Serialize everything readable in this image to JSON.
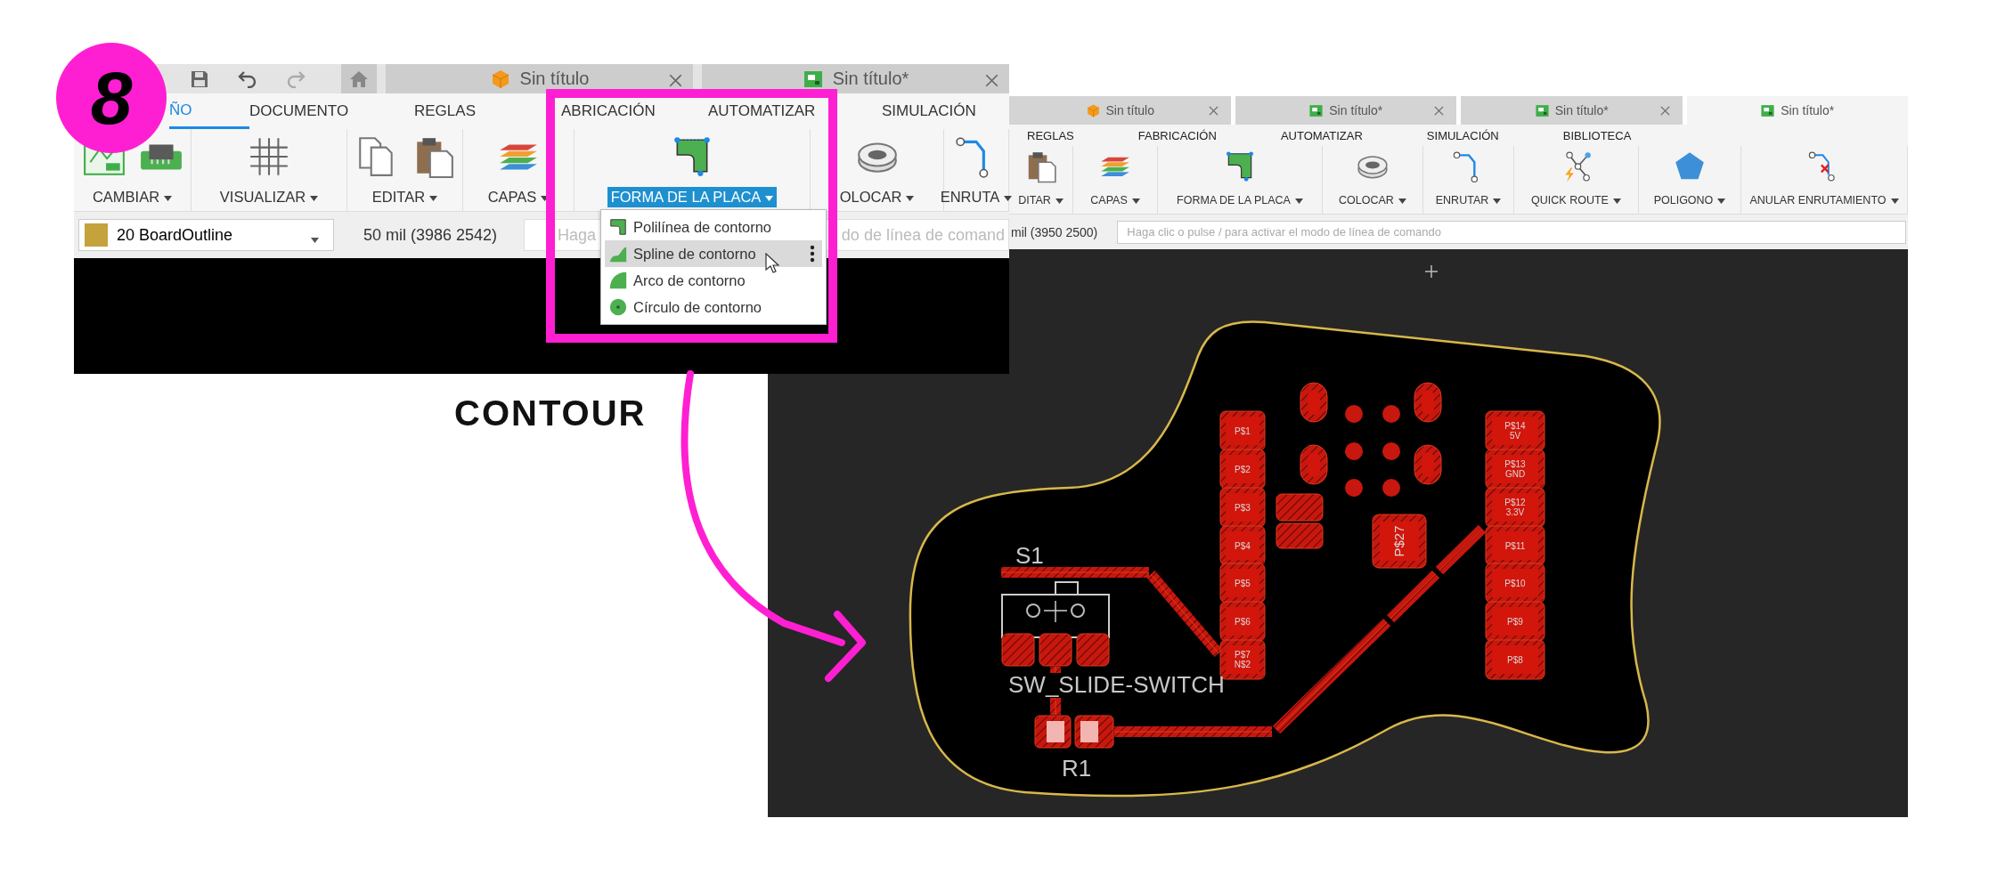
{
  "step_badge": "8",
  "caption": "CONTOUR",
  "left_window": {
    "doc_tabs": [
      {
        "label": "Sin título",
        "selected": false
      },
      {
        "label": "Sin título*",
        "selected": false
      }
    ],
    "ribbon_tabs": [
      {
        "label": "ÑO",
        "selected": true
      },
      {
        "label": "DOCUMENTO",
        "selected": false
      },
      {
        "label": "REGLAS",
        "selected": false
      },
      {
        "label": "ABRICACIÓN",
        "selected": false
      },
      {
        "label": "AUTOMATIZAR",
        "selected": false
      },
      {
        "label": "SIMULACIÓN",
        "selected": false
      }
    ],
    "tool_groups": [
      {
        "label": "CAMBIAR",
        "selected": false
      },
      {
        "label": "VISUALIZAR",
        "selected": false
      },
      {
        "label": "EDITAR",
        "selected": false
      },
      {
        "label": "CAPAS",
        "selected": false
      },
      {
        "label": "FORMA DE LA PLACA",
        "selected": true
      },
      {
        "label": "OLOCAR",
        "selected": false
      },
      {
        "label": "ENRUTA",
        "selected": false
      }
    ],
    "layer": "20 BoardOutline",
    "coordinates": "50 mil (3986 2542)",
    "command_placeholder_parts": [
      "Haga",
      "do de línea de comand"
    ],
    "menu": [
      {
        "label": "Polilínea de contorno",
        "selected": false
      },
      {
        "label": "Spline de contorno",
        "selected": true
      },
      {
        "label": "Arco de contorno",
        "selected": false
      },
      {
        "label": "Círculo de contorno",
        "selected": false
      }
    ]
  },
  "right_window": {
    "doc_tabs": [
      {
        "label": "Sin título",
        "selected": false
      },
      {
        "label": "Sin título*",
        "selected": false
      },
      {
        "label": "Sin título*",
        "selected": false
      },
      {
        "label": "Sin título*",
        "selected": true
      }
    ],
    "ribbon_tabs": [
      {
        "label": "REGLAS",
        "selected": false
      },
      {
        "label": "FABRICACIÓN",
        "selected": false
      },
      {
        "label": "AUTOMATIZAR",
        "selected": false
      },
      {
        "label": "SIMULACIÓN",
        "selected": false
      },
      {
        "label": "BIBLIOTECA",
        "selected": false
      }
    ],
    "tool_groups": [
      {
        "label": "DITAR",
        "selected": false
      },
      {
        "label": "CAPAS",
        "selected": false
      },
      {
        "label": "FORMA DE LA PLACA",
        "selected": false
      },
      {
        "label": "COLOCAR",
        "selected": false
      },
      {
        "label": "ENRUTAR",
        "selected": false
      },
      {
        "label": "QUICK ROUTE",
        "selected": false
      },
      {
        "label": "POLIGONO",
        "selected": false
      },
      {
        "label": "ANULAR ENRUTAMIENTO",
        "selected": false
      }
    ],
    "coordinates": "mil (3950 2500)",
    "command_placeholder": "Haga clic o pulse / para activar el modo de línea de comando"
  },
  "board": {
    "switch_name": "S1",
    "switch_value": "SW_SLIDE-SWITCH",
    "resistor_name": "R1",
    "center_pad": "P$27",
    "pads_left": [
      {
        "label": "P$1"
      },
      {
        "label": "P$2"
      },
      {
        "label": "P$3"
      },
      {
        "label": "P$4"
      },
      {
        "label": "P$5"
      },
      {
        "label": "P$6"
      },
      {
        "label": "P$7",
        "net": "N$2"
      }
    ],
    "pads_right": [
      {
        "label": "P$14",
        "net": "5V"
      },
      {
        "label": "P$13",
        "net": "GND"
      },
      {
        "label": "P$12",
        "net": "3.3V"
      },
      {
        "label": "P$11"
      },
      {
        "label": "P$10"
      },
      {
        "label": "P$9"
      },
      {
        "label": "P$8"
      }
    ]
  }
}
